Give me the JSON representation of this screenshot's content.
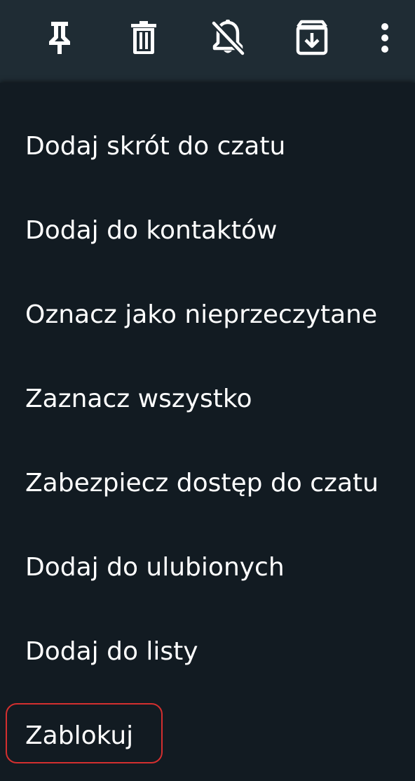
{
  "toolbar": {
    "icons": [
      "pin-icon",
      "trash-icon",
      "mute-bell-icon",
      "archive-icon",
      "more-vertical-icon"
    ]
  },
  "menu": {
    "items": [
      {
        "label": "Dodaj skrót do czatu"
      },
      {
        "label": "Dodaj do kontaktów"
      },
      {
        "label": "Oznacz jako nieprzeczytane"
      },
      {
        "label": "Zaznacz wszystko"
      },
      {
        "label": "Zabezpiecz dostęp do czatu"
      },
      {
        "label": "Dodaj do ulubionych"
      },
      {
        "label": "Dodaj do listy"
      },
      {
        "label": "Zablokuj"
      }
    ]
  },
  "colors": {
    "background": "#121b22",
    "toolbar": "#1f2c34",
    "text": "#ffffff",
    "highlight": "#d32f2f"
  }
}
